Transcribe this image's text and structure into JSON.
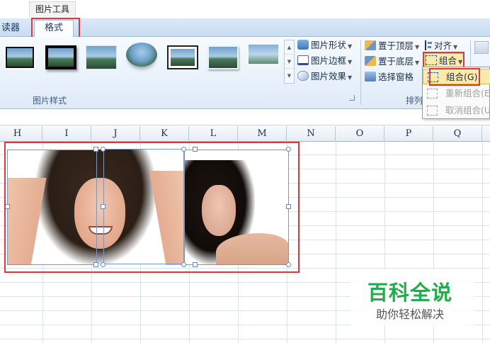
{
  "contextual_tab": "图片工具",
  "tabs": {
    "reader_partial": "读器",
    "format": "格式"
  },
  "ribbon": {
    "picture_styles_label": "图片样式",
    "picture_shape": "图片形状",
    "picture_border": "图片边框",
    "picture_effects": "图片效果",
    "bring_to_front": "置于顶层",
    "send_to_back": "置于底层",
    "selection_pane": "选择窗格",
    "align": "对齐",
    "group": "组合",
    "arrange_label_partial": "排列"
  },
  "group_menu": {
    "items": [
      {
        "label": "组合(G)",
        "state": "hover"
      },
      {
        "label": "重新组合(E)",
        "state": "disabled"
      },
      {
        "label": "取消组合(U)",
        "state": "disabled"
      }
    ]
  },
  "columns": [
    "H",
    "I",
    "J",
    "K",
    "L",
    "M",
    "N",
    "O",
    "P",
    "Q"
  ],
  "watermark": {
    "title": "百科全说",
    "subtitle": "助你轻松解决"
  },
  "colors": {
    "highlight": "#d9393c",
    "watermark_green": "#1fae4b",
    "ribbon_blue": "#c9dcf2"
  }
}
